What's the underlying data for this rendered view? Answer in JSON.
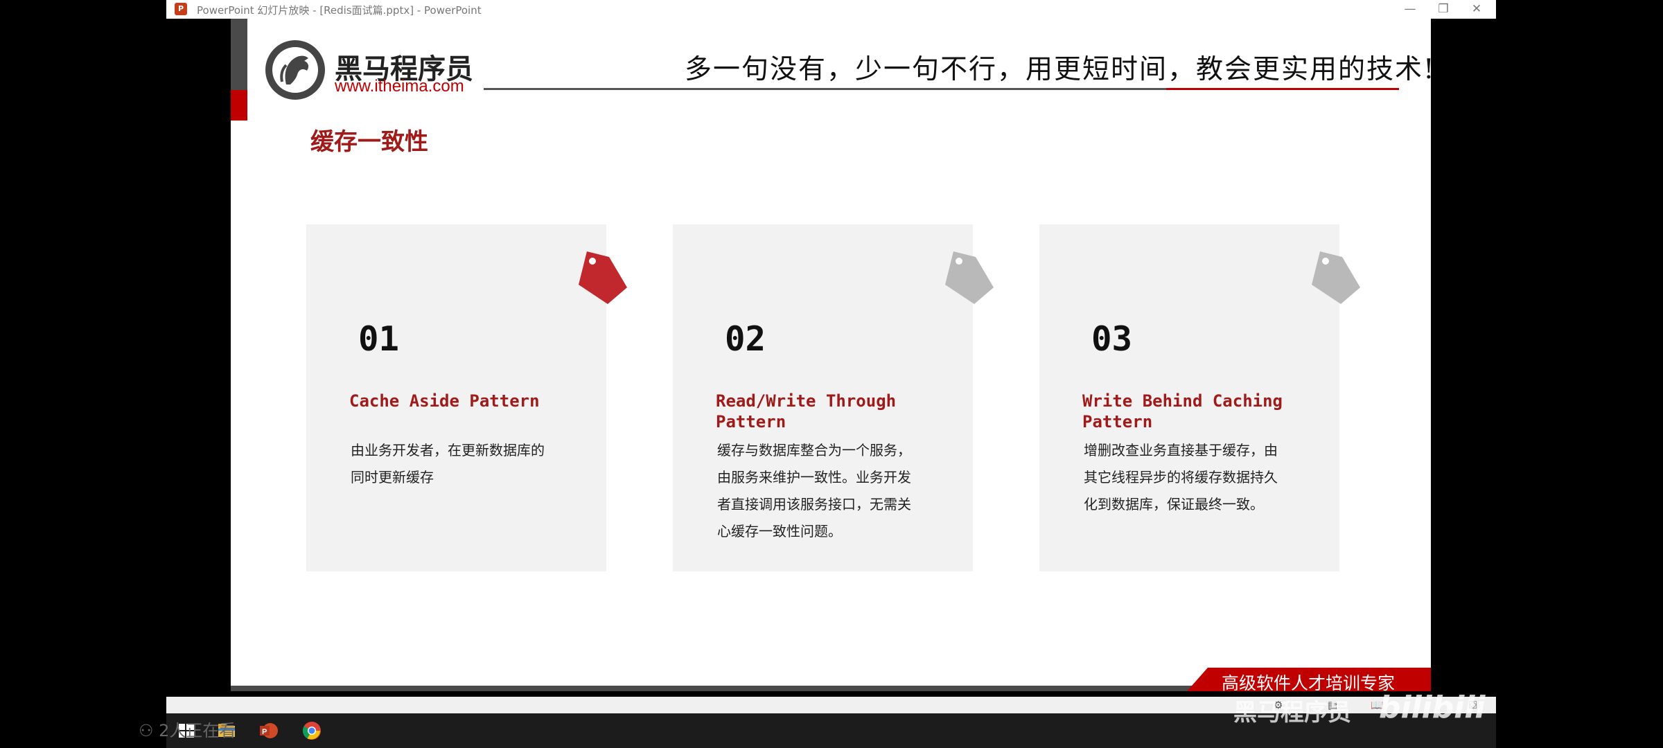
{
  "window": {
    "title": "PowerPoint 幻灯片放映 - [Redis面试篇.pptx] - PowerPoint",
    "app_icon": "P",
    "minimize": "—",
    "restore": "❐",
    "close": "✕"
  },
  "slide": {
    "logo_cn": "黑马程序员",
    "logo_url": "www.itheima.com",
    "slogan": "多一句没有，少一句不行，用更短时间，教会更实用的技术!",
    "heading": "缓存一致性",
    "cards": [
      {
        "num": "01",
        "title": "Cache Aside Pattern",
        "desc": [
          "由业务开发者，在更新数据库的",
          "同时更新缓存"
        ],
        "tag_color": "#c0282d"
      },
      {
        "num": "02",
        "title": "Read/Write Through Pattern",
        "desc": [
          "缓存与数据库整合为一个服务，",
          "由服务来维护一致性。业务开发",
          "者直接调用该服务接口，无需关",
          "心缓存一致性问题。"
        ],
        "tag_color": "#b9b9b9"
      },
      {
        "num": "03",
        "title": "Write Behind Caching Pattern",
        "desc": [
          "增删改查业务直接基于缓存，由",
          "其它线程异步的将缓存数据持久",
          "化到数据库，保证最终一致。"
        ],
        "tag_color": "#b9b9b9"
      }
    ],
    "footer": "高级软件人才培训专家"
  },
  "overlay": {
    "watch_count": "2人正在看",
    "watermark_text": "黑马程序员",
    "watermark_logo": "bilibili"
  },
  "colors": {
    "accent": "#c00000",
    "heading": "#a01a1a",
    "card_bg": "#f2f2f2"
  }
}
